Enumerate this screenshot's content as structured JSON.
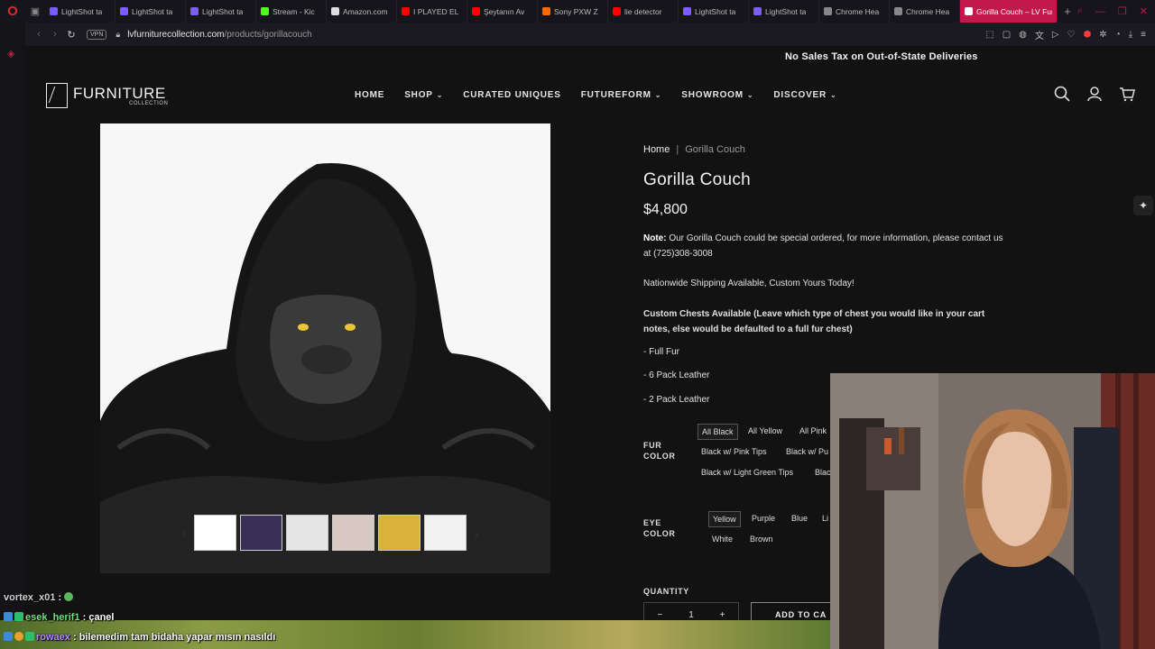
{
  "browser": {
    "tabs": [
      {
        "label": "LightShot ta",
        "color": "#7b5cff"
      },
      {
        "label": "LightShot ta",
        "color": "#7b5cff"
      },
      {
        "label": "LightShot ta",
        "color": "#7b5cff"
      },
      {
        "label": "Stream - Kic",
        "color": "#53fc18"
      },
      {
        "label": "Amazon.com",
        "color": "#dddddd"
      },
      {
        "label": "I PLAYED EL",
        "color": "#ff0000"
      },
      {
        "label": "Şeytanın Av",
        "color": "#ff0000"
      },
      {
        "label": "Sony PXW Z",
        "color": "#ff6a00"
      },
      {
        "label": "lie detector",
        "color": "#ff0000"
      },
      {
        "label": "LightShot ta",
        "color": "#7b5cff"
      },
      {
        "label": "LightShot ta",
        "color": "#7b5cff"
      },
      {
        "label": "Chrome Hea",
        "color": "#888888"
      },
      {
        "label": "Chrome Hea",
        "color": "#888888"
      }
    ],
    "active_tab": "Gorilla Couch – LV Furn",
    "url_domain": "lvfurniturecollection.com",
    "url_path": "/products/gorillacouch",
    "vpn_label": "VPN"
  },
  "site": {
    "promo": "No Sales Tax on Out-of-State Deliveries",
    "logo_main": "FURNITURE",
    "logo_sub": "COLLECTION",
    "nav": [
      {
        "label": "HOME",
        "dropdown": false
      },
      {
        "label": "SHOP",
        "dropdown": true
      },
      {
        "label": "CURATED UNIQUES",
        "dropdown": false
      },
      {
        "label": "FUTUREFORM",
        "dropdown": true
      },
      {
        "label": "SHOWROOM",
        "dropdown": true
      },
      {
        "label": "DISCOVER",
        "dropdown": true
      }
    ]
  },
  "product": {
    "crumb_home": "Home",
    "crumb_sep": "|",
    "crumb_current": "Gorilla Couch",
    "title": "Gorilla Couch",
    "price": "$4,800",
    "note_label": "Note:",
    "note_text": " Our Gorilla Couch could be special ordered, for more information, please contact us at (725)308-3008",
    "shipping": "Nationwide Shipping Available, Custom Yours Today!",
    "chests_heading": "Custom Chests Available (Leave which type of chest you would like in your cart notes, else would be defaulted to a full fur chest)",
    "chest_options": [
      "- Full Fur",
      "- 6 Pack Leather",
      "- 2 Pack Leather"
    ],
    "fur_label_1": "FUR",
    "fur_label_2": "COLOR",
    "fur_options": [
      "All Black",
      "All Yellow",
      "All Pink",
      "Black w/ Pink Tips",
      "Black w/ Pu",
      "Black w/ Light Green Tips",
      "Blac"
    ],
    "eye_label_1": "EYE",
    "eye_label_2": "COLOR",
    "eye_options": [
      "Yellow",
      "Purple",
      "Blue",
      "Li",
      "White",
      "Brown"
    ],
    "quantity_label": "QUANTITY",
    "qty_minus": "−",
    "qty_value": "1",
    "qty_plus": "+",
    "add_to_cart": "ADD TO CA"
  },
  "chat": [
    {
      "user": "vortex_x01",
      "sep": " : ",
      "text": ""
    },
    {
      "user": "esek_herif1",
      "sep": " : ",
      "text": "çanel"
    },
    {
      "user": "rowaex",
      "sep": " : ",
      "text": "bilemedim tam bidaha yapar mısın nasıldı"
    }
  ]
}
